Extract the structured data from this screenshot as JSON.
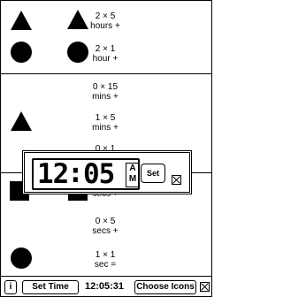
{
  "rows": [
    {
      "label_line1": "2 × 5",
      "label_line2": "hours +"
    },
    {
      "label_line1": "2 × 1",
      "label_line2": "hour +"
    },
    {
      "label_line1": "0 × 15",
      "label_line2": "mins +"
    },
    {
      "label_line1": "1 × 5",
      "label_line2": "mins +"
    },
    {
      "label_line1": "0 × 1",
      "label_line2": ""
    },
    {
      "label_line1": "",
      "label_line2": "secs +"
    },
    {
      "label_line1": "0 × 5",
      "label_line2": "secs +"
    },
    {
      "label_line1": "1 × 1",
      "label_line2": "sec ="
    }
  ],
  "clock": {
    "hour": "12",
    "colon": ":",
    "minute": "05",
    "ampm_top": "A",
    "ampm_bottom": "M",
    "set_label": "Set"
  },
  "bottom_bar": {
    "info_label": "i",
    "set_time_label": "Set Time",
    "time": "12:05:31",
    "choose_icons_label": "Choose Icons"
  }
}
